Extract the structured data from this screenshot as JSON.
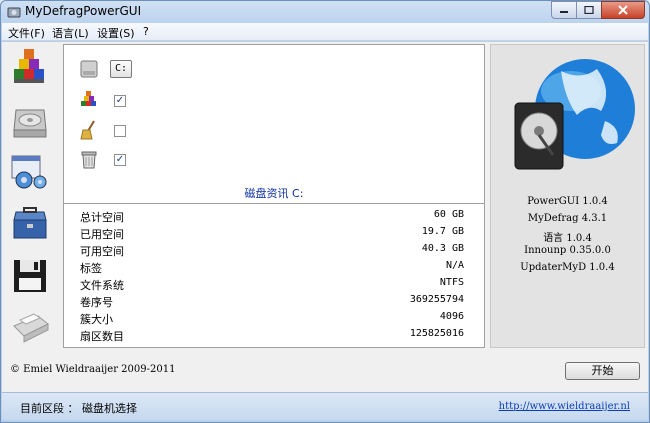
{
  "window": {
    "title": "MyDefragPowerGUI"
  },
  "menu": [
    {
      "label": "文件(F)"
    },
    {
      "label": "语言(L)"
    },
    {
      "label": "设置(S)"
    },
    {
      "label": "?"
    }
  ],
  "sidebar_icons": [
    "defrag-blocks-icon",
    "hard-disk-icon",
    "settings-gears-icon",
    "toolbox-icon",
    "floppy-save-icon",
    "printer-icon"
  ],
  "options": {
    "drive_button": "C:",
    "defrag_checked": true,
    "clean_checked": false,
    "recycle_checked": true
  },
  "disk": {
    "title": "磁盘资讯 C:",
    "rows": [
      {
        "label": "总计空间",
        "value": "60 GB"
      },
      {
        "label": "已用空间",
        "value": "19.7 GB"
      },
      {
        "label": "可用空间",
        "value": "40.3 GB"
      },
      {
        "label": "标签",
        "value": "N/A"
      },
      {
        "label": "文件系统",
        "value": "NTFS"
      },
      {
        "label": "卷序号",
        "value": "369255794"
      },
      {
        "label": "簇大小",
        "value": "4096"
      },
      {
        "label": "扇区数目",
        "value": "125825016"
      }
    ]
  },
  "versions": [
    "PowerGUI 1.0.4",
    "MyDefrag 4.3.1",
    "语言 1.0.4",
    "Innounp 0.35.0.0",
    "UpdaterMyD 1.0.4"
  ],
  "footer": {
    "copyright": "© Emiel Wieldraaijer 2009-2011",
    "start_button": "开始"
  },
  "status": {
    "text": "目前区段 ： 磁盘机选择",
    "link": "http://www.wieldraaijer.nl"
  },
  "colors": {
    "link": "#0b3fb3",
    "disk_title": "#0a2ea3"
  }
}
